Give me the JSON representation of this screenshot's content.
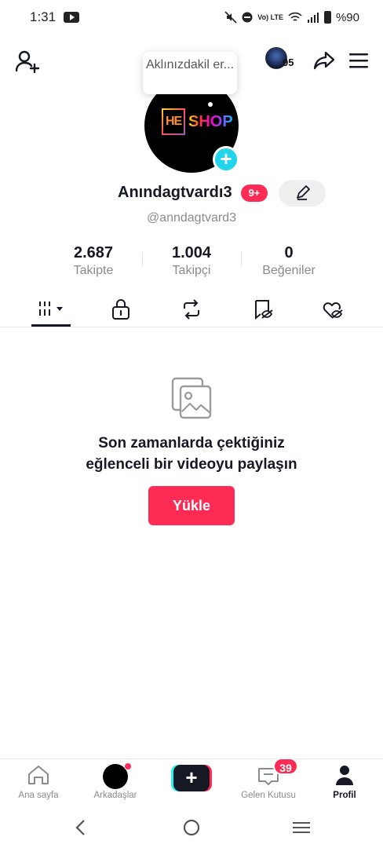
{
  "status_bar": {
    "time": "1:31",
    "network_label": "Vo) LTE",
    "battery": "%90"
  },
  "tooltip": {
    "text": "Aklınızdakil er..."
  },
  "header": {
    "avatar_count": "95"
  },
  "profile": {
    "logo_text": "SHOP",
    "logo_letters": "HE",
    "display_name": "Anındagtvardı3",
    "notification_badge": "9+",
    "handle": "@anndagtvard3"
  },
  "stats": [
    {
      "value": "2.687",
      "label": "Takipte"
    },
    {
      "value": "1.004",
      "label": "Takipçi"
    },
    {
      "value": "0",
      "label": "Beğeniler"
    }
  ],
  "tabs": [
    {
      "name": "videos",
      "icon": "grid-icon",
      "active": true
    },
    {
      "name": "private",
      "icon": "lock-icon",
      "active": false
    },
    {
      "name": "reposts",
      "icon": "repost-icon",
      "active": false
    },
    {
      "name": "favorites",
      "icon": "bookmark-icon",
      "active": false
    },
    {
      "name": "liked",
      "icon": "heart-hidden-icon",
      "active": false
    }
  ],
  "empty_state": {
    "line1": "Son zamanlarda çektiğiniz",
    "line2": "eğlenceli bir videoyu paylaşın",
    "button": "Yükle"
  },
  "bottom_nav": {
    "home": "Ana sayfa",
    "friends": "Arkadaşlar",
    "inbox": "Gelen Kutusu",
    "inbox_badge": "39",
    "profile": "Profil"
  },
  "colors": {
    "accent": "#fe2c55",
    "cyan": "#20d5ec",
    "text": "#161823",
    "muted": "#8a8b91"
  }
}
